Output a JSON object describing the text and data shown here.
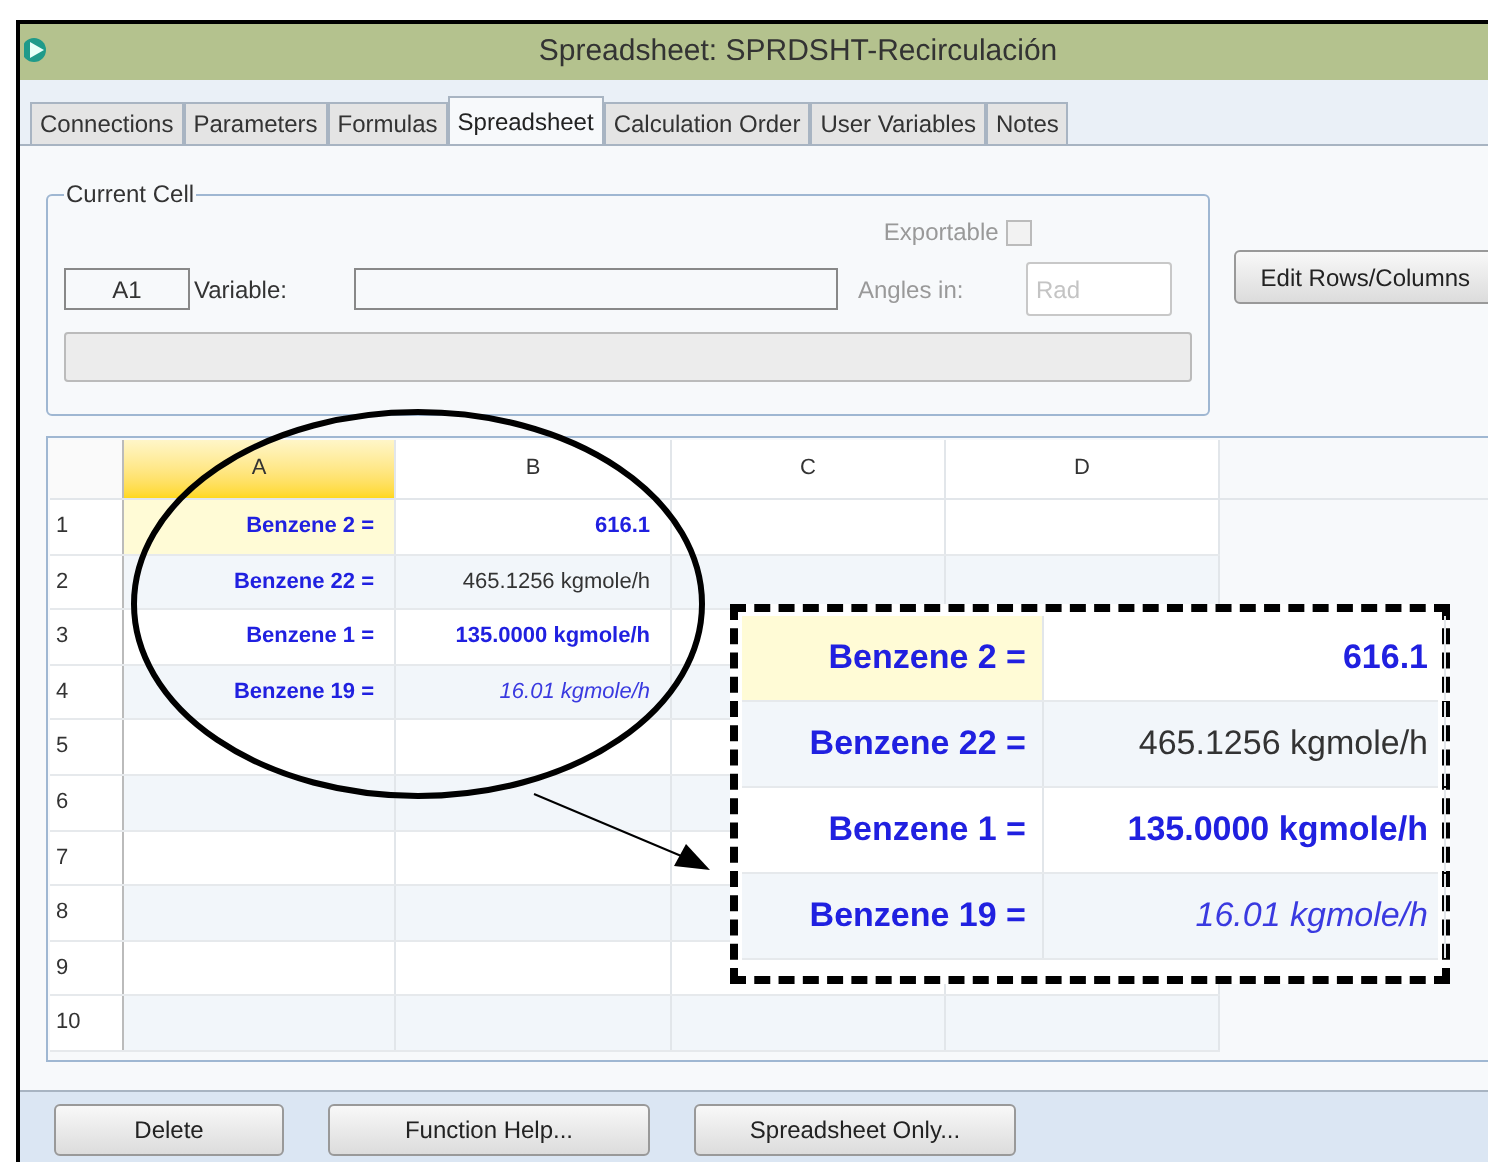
{
  "window": {
    "title": "Spreadsheet: SPRDSHT-Recirculación"
  },
  "tabs": [
    {
      "label": "Connections",
      "selected": false
    },
    {
      "label": "Parameters",
      "selected": false
    },
    {
      "label": "Formulas",
      "selected": false
    },
    {
      "label": "Spreadsheet",
      "selected": true
    },
    {
      "label": "Calculation Order",
      "selected": false
    },
    {
      "label": "User Variables",
      "selected": false
    },
    {
      "label": "Notes",
      "selected": false
    }
  ],
  "current_cell": {
    "title": "Current Cell",
    "cell": "A1",
    "variable_label": "Variable:",
    "exportable": {
      "label": "Exportable",
      "checked": false,
      "disabled": true
    },
    "angles": {
      "label": "Angles in:",
      "placeholder": "Rad",
      "disabled": true
    }
  },
  "edit_button": "Edit Rows/Columns",
  "grid": {
    "columns": [
      {
        "label": "A",
        "selected": true
      },
      {
        "label": "B",
        "selected": false
      },
      {
        "label": "C",
        "selected": false
      },
      {
        "label": "D",
        "selected": false
      }
    ],
    "rows": [
      {
        "number": "1",
        "cells": [
          {
            "text": "Benzene 2 =",
            "kind": "label",
            "selected": true
          },
          {
            "text": "616.1",
            "kind": "strong",
            "selected": false
          }
        ]
      },
      {
        "number": "2",
        "cells": [
          {
            "text": "Benzene 22 =",
            "kind": "label",
            "selected": false
          },
          {
            "text": "465.1256 kgmole/h",
            "kind": "plain",
            "selected": false
          }
        ]
      },
      {
        "number": "3",
        "cells": [
          {
            "text": "Benzene 1 =",
            "kind": "label",
            "selected": false
          },
          {
            "text": "135.0000 kgmole/h",
            "kind": "strong",
            "selected": false
          }
        ]
      },
      {
        "number": "4",
        "cells": [
          {
            "text": "Benzene 19 =",
            "kind": "label",
            "selected": false
          },
          {
            "text": "16.01 kgmole/h",
            "kind": "italic",
            "selected": false
          }
        ]
      },
      {
        "number": "5",
        "cells": []
      },
      {
        "number": "6",
        "cells": []
      },
      {
        "number": "7",
        "cells": []
      },
      {
        "number": "8",
        "cells": []
      },
      {
        "number": "9",
        "cells": []
      },
      {
        "number": "10",
        "cells": []
      }
    ]
  },
  "callout": {
    "rows": [
      {
        "cells": [
          {
            "text": "Benzene 2 =",
            "kind": "label",
            "selected": true
          },
          {
            "text": "616.1",
            "kind": "strong",
            "selected": false
          }
        ]
      },
      {
        "cells": [
          {
            "text": "Benzene 22 =",
            "kind": "label",
            "selected": false
          },
          {
            "text": "465.1256 kgmole/h",
            "kind": "plain",
            "selected": false
          }
        ]
      },
      {
        "cells": [
          {
            "text": "Benzene 1 =",
            "kind": "label",
            "selected": false
          },
          {
            "text": "135.0000 kgmole/h",
            "kind": "strong",
            "selected": false
          }
        ]
      },
      {
        "cells": [
          {
            "text": "Benzene 19 =",
            "kind": "label",
            "selected": false
          },
          {
            "text": "16.01 kgmole/h",
            "kind": "italic",
            "selected": false
          }
        ]
      }
    ]
  },
  "buttons": [
    "Delete",
    "Function Help...",
    "Spreadsheet Only..."
  ]
}
